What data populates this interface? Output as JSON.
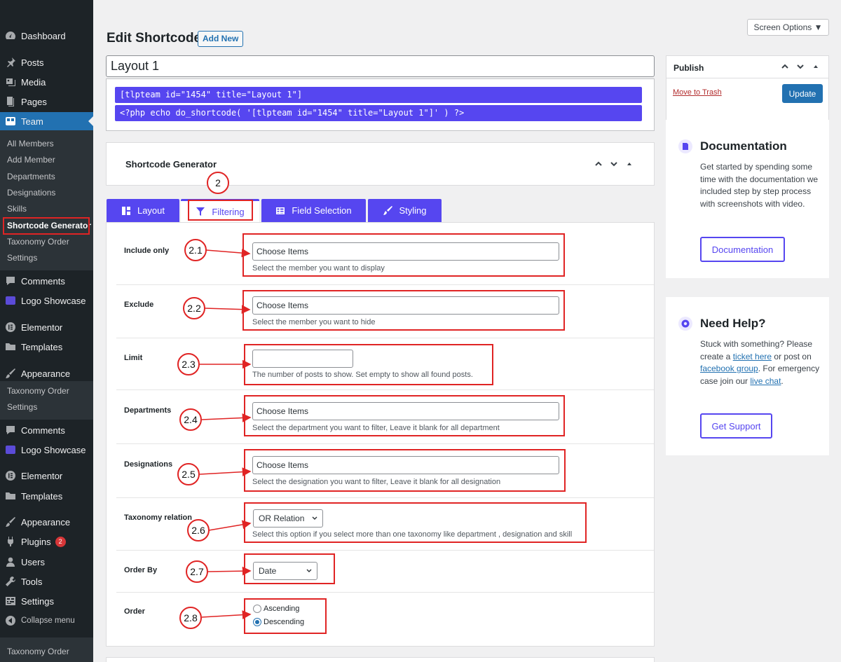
{
  "sidebar": {
    "menu": [
      {
        "label": "Dashboard",
        "icon": "dashboard-icon"
      },
      {
        "label": "Posts",
        "icon": "pin-icon"
      },
      {
        "label": "Media",
        "icon": "media-icon"
      },
      {
        "label": "Pages",
        "icon": "pages-icon"
      },
      {
        "label": "Team",
        "icon": "team-icon"
      },
      {
        "label": "Comments",
        "icon": "comment-icon"
      },
      {
        "label": "Logo Showcase",
        "icon": "logo-showcase-icon"
      },
      {
        "label": "Elementor",
        "icon": "elementor-icon"
      },
      {
        "label": "Templates",
        "icon": "folder-icon"
      },
      {
        "label": "Appearance",
        "icon": "brush-icon"
      },
      {
        "label": "Comments",
        "icon": "comment-icon"
      },
      {
        "label": "Logo Showcase",
        "icon": "logo-showcase-icon"
      },
      {
        "label": "Elementor",
        "icon": "elementor-icon"
      },
      {
        "label": "Templates",
        "icon": "folder-icon"
      },
      {
        "label": "Appearance",
        "icon": "brush-icon"
      },
      {
        "label": "Plugins",
        "icon": "plugin-icon",
        "badge": "2"
      },
      {
        "label": "Users",
        "icon": "user-icon"
      },
      {
        "label": "Tools",
        "icon": "wrench-icon"
      },
      {
        "label": "Settings",
        "icon": "settings-icon"
      },
      {
        "label": "Collapse menu",
        "icon": "collapse-icon"
      }
    ],
    "team_sub": [
      "All Members",
      "Add Member",
      "Departments",
      "Designations",
      "Skills",
      "Shortcode Generator",
      "Taxonomy Order",
      "Settings"
    ],
    "appearance_sub": [
      "Taxonomy Order",
      "Settings"
    ],
    "bottom_sub": "Taxonomy Order"
  },
  "header": {
    "title": "Edit Shortcode",
    "add_new": "Add New",
    "screen_options": "Screen Options ▼"
  },
  "post": {
    "title": "Layout 1",
    "shortcode": "[tlpteam id=\"1454\" title=\"Layout 1\"]",
    "php_code": "<?php echo do_shortcode( '[tlpteam id=\"1454\" title=\"Layout 1\"]' ) ?>"
  },
  "generator": {
    "title": "Shortcode Generator",
    "tabs": [
      {
        "label": "Layout",
        "icon": "layout-icon"
      },
      {
        "label": "Filtering",
        "icon": "filter-icon"
      },
      {
        "label": "Field Selection",
        "icon": "table-icon"
      },
      {
        "label": "Styling",
        "icon": "brush-icon"
      }
    ],
    "fields": {
      "include_only": {
        "label": "Include only",
        "placeholder": "Choose Items",
        "desc": "Select the member you want to display"
      },
      "exclude": {
        "label": "Exclude",
        "placeholder": "Choose Items",
        "desc": "Select the member you want to hide"
      },
      "limit": {
        "label": "Limit",
        "value": "",
        "desc": "The number of posts to show. Set empty to show all found posts."
      },
      "departments": {
        "label": "Departments",
        "placeholder": "Choose Items",
        "desc": "Select the department you want to filter, Leave it blank for all department"
      },
      "designations": {
        "label": "Designations",
        "placeholder": "Choose Items",
        "desc": "Select the designation you want to filter, Leave it blank for all designation"
      },
      "taxonomy_relation": {
        "label": "Taxonomy relation",
        "value": "OR Relation",
        "desc": "Select this option if you select more than one taxonomy like department , designation and skill"
      },
      "order_by": {
        "label": "Order By",
        "value": "Date"
      },
      "order": {
        "label": "Order",
        "options": [
          "Ascending",
          "Descending"
        ],
        "selected": "Descending"
      }
    }
  },
  "callouts": [
    "2",
    "2.1",
    "2.2",
    "2.3",
    "2.4",
    "2.5",
    "2.6",
    "2.7",
    "2.8"
  ],
  "publish": {
    "title": "Publish",
    "trash": "Move to Trash",
    "update": "Update"
  },
  "documentation": {
    "title": "Documentation",
    "text": "Get started by spending some time with the documentation we included step by step process with screenshots with video.",
    "button": "Documentation"
  },
  "help": {
    "title": "Need Help?",
    "text_1": "Stuck with something? Please create a ",
    "link_1": "ticket here",
    "text_2": " or post on ",
    "link_2": "facebook group",
    "text_3": ". For emergency case join our ",
    "link_3": "live chat",
    "text_4": ".",
    "button": "Get Support"
  },
  "colors": {
    "accent": "#5646f0",
    "wp_blue": "#2271b1",
    "sidebar": "#1d2327",
    "annotation": "#e02424"
  }
}
